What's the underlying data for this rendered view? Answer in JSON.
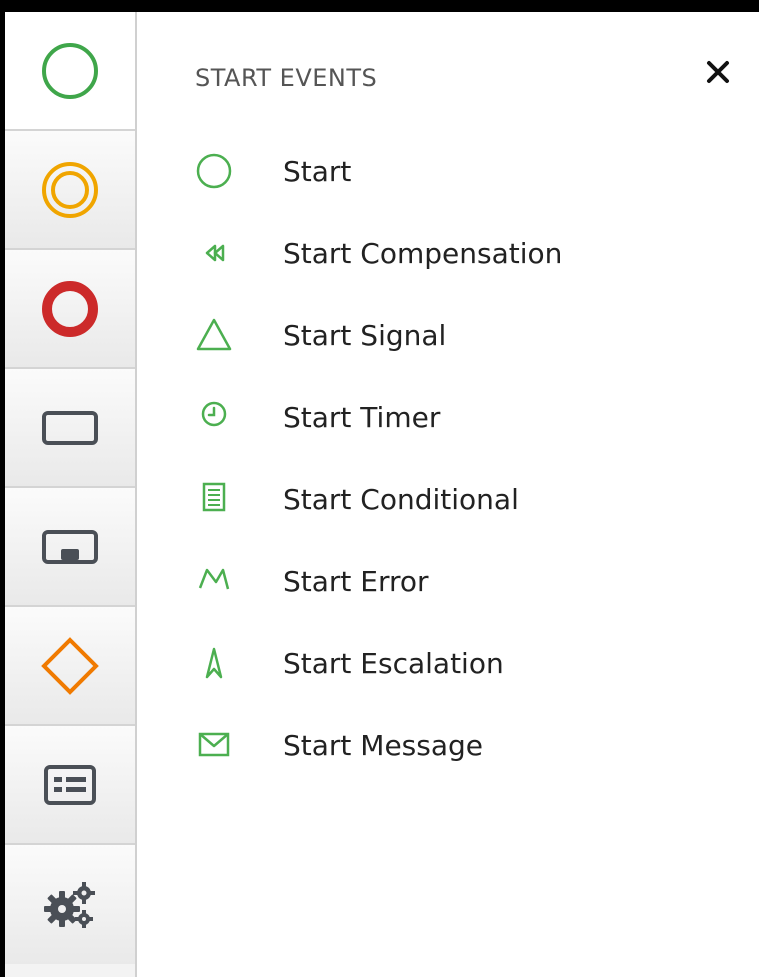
{
  "rail": {
    "items": [
      {
        "icon": "start-event-icon",
        "color": "#3fa64a"
      },
      {
        "icon": "intermediate-event-icon",
        "color": "#f0a500"
      },
      {
        "icon": "end-event-icon",
        "color": "#cc2a2a"
      },
      {
        "icon": "task-icon",
        "color": "#4a4f56"
      },
      {
        "icon": "subprocess-icon",
        "color": "#4a4f56"
      },
      {
        "icon": "gateway-icon",
        "color": "#f07a00"
      },
      {
        "icon": "data-object-icon",
        "color": "#4a4f56"
      },
      {
        "icon": "gears-icon",
        "color": "#4a4f56"
      }
    ]
  },
  "panel": {
    "title": "START EVENTS",
    "close_icon": "close-icon",
    "icon_color": "#4caf50",
    "items": [
      {
        "label": "Start",
        "icon": "start-circle-icon"
      },
      {
        "label": "Start Compensation",
        "icon": "compensation-icon"
      },
      {
        "label": "Start Signal",
        "icon": "signal-triangle-icon"
      },
      {
        "label": "Start Timer",
        "icon": "timer-clock-icon"
      },
      {
        "label": "Start Conditional",
        "icon": "conditional-document-icon"
      },
      {
        "label": "Start Error",
        "icon": "error-lightning-icon"
      },
      {
        "label": "Start Escalation",
        "icon": "escalation-arrow-icon"
      },
      {
        "label": "Start Message",
        "icon": "message-envelope-icon"
      }
    ]
  }
}
